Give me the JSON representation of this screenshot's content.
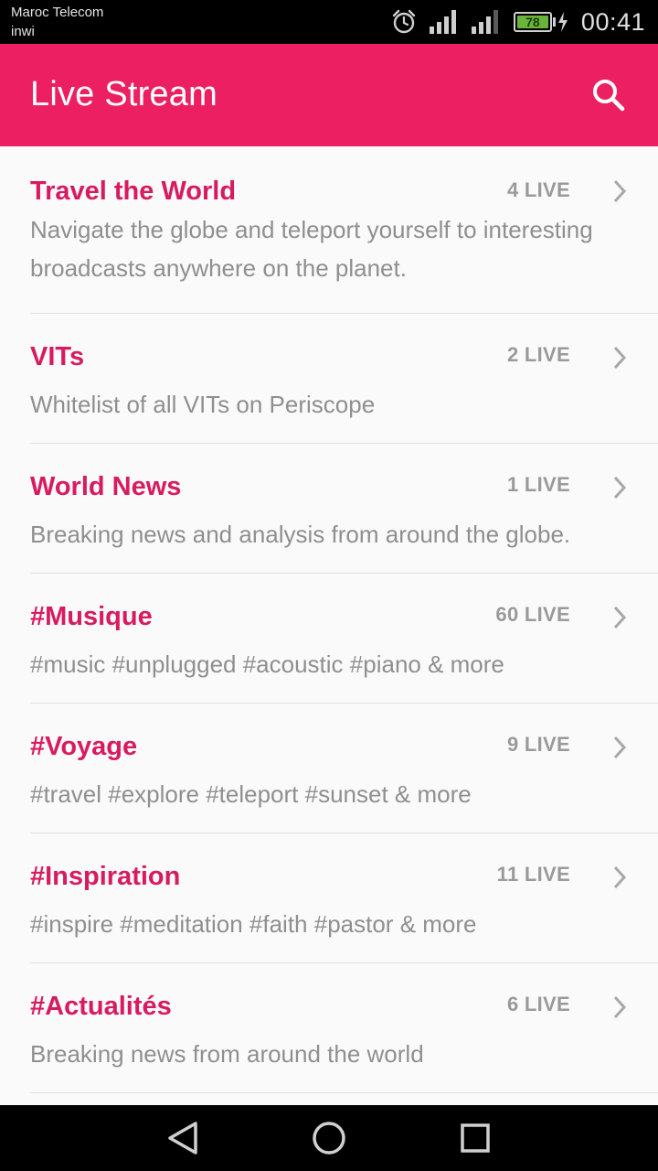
{
  "status_bar": {
    "carrier_primary": "Maroc Telecom",
    "carrier_secondary": "inwi",
    "battery_level": "78",
    "time": "00:41",
    "icons": [
      "alarm-icon",
      "signal-icon",
      "signal-icon",
      "battery-charging-icon"
    ]
  },
  "app_bar": {
    "title": "Live Stream",
    "search_icon": "search-icon",
    "color": "#ec1f63"
  },
  "channels": [
    {
      "title": "Travel the World",
      "count": "4 LIVE",
      "description": "Navigate the globe and teleport yourself to interesting broadcasts anywhere on the planet."
    },
    {
      "title": "VITs",
      "count": "2 LIVE",
      "description": "Whitelist of all VITs on Periscope"
    },
    {
      "title": "World News",
      "count": "1 LIVE",
      "description": "Breaking news and analysis from around the globe."
    },
    {
      "title": "#Musique",
      "count": "60 LIVE",
      "description": "#music #unplugged #acoustic #piano & more"
    },
    {
      "title": "#Voyage",
      "count": "9 LIVE",
      "description": "#travel #explore #teleport #sunset & more"
    },
    {
      "title": "#Inspiration",
      "count": "11 LIVE",
      "description": "#inspire #meditation #faith #pastor & more"
    },
    {
      "title": "#Actualités",
      "count": "6 LIVE",
      "description": "Breaking news from around the world"
    }
  ],
  "colors": {
    "title": "#d81b60",
    "count": "#9a9a9a",
    "description": "#8f8f8f"
  },
  "nav_bar": {
    "buttons": [
      "back-icon",
      "home-icon",
      "recents-icon"
    ]
  }
}
